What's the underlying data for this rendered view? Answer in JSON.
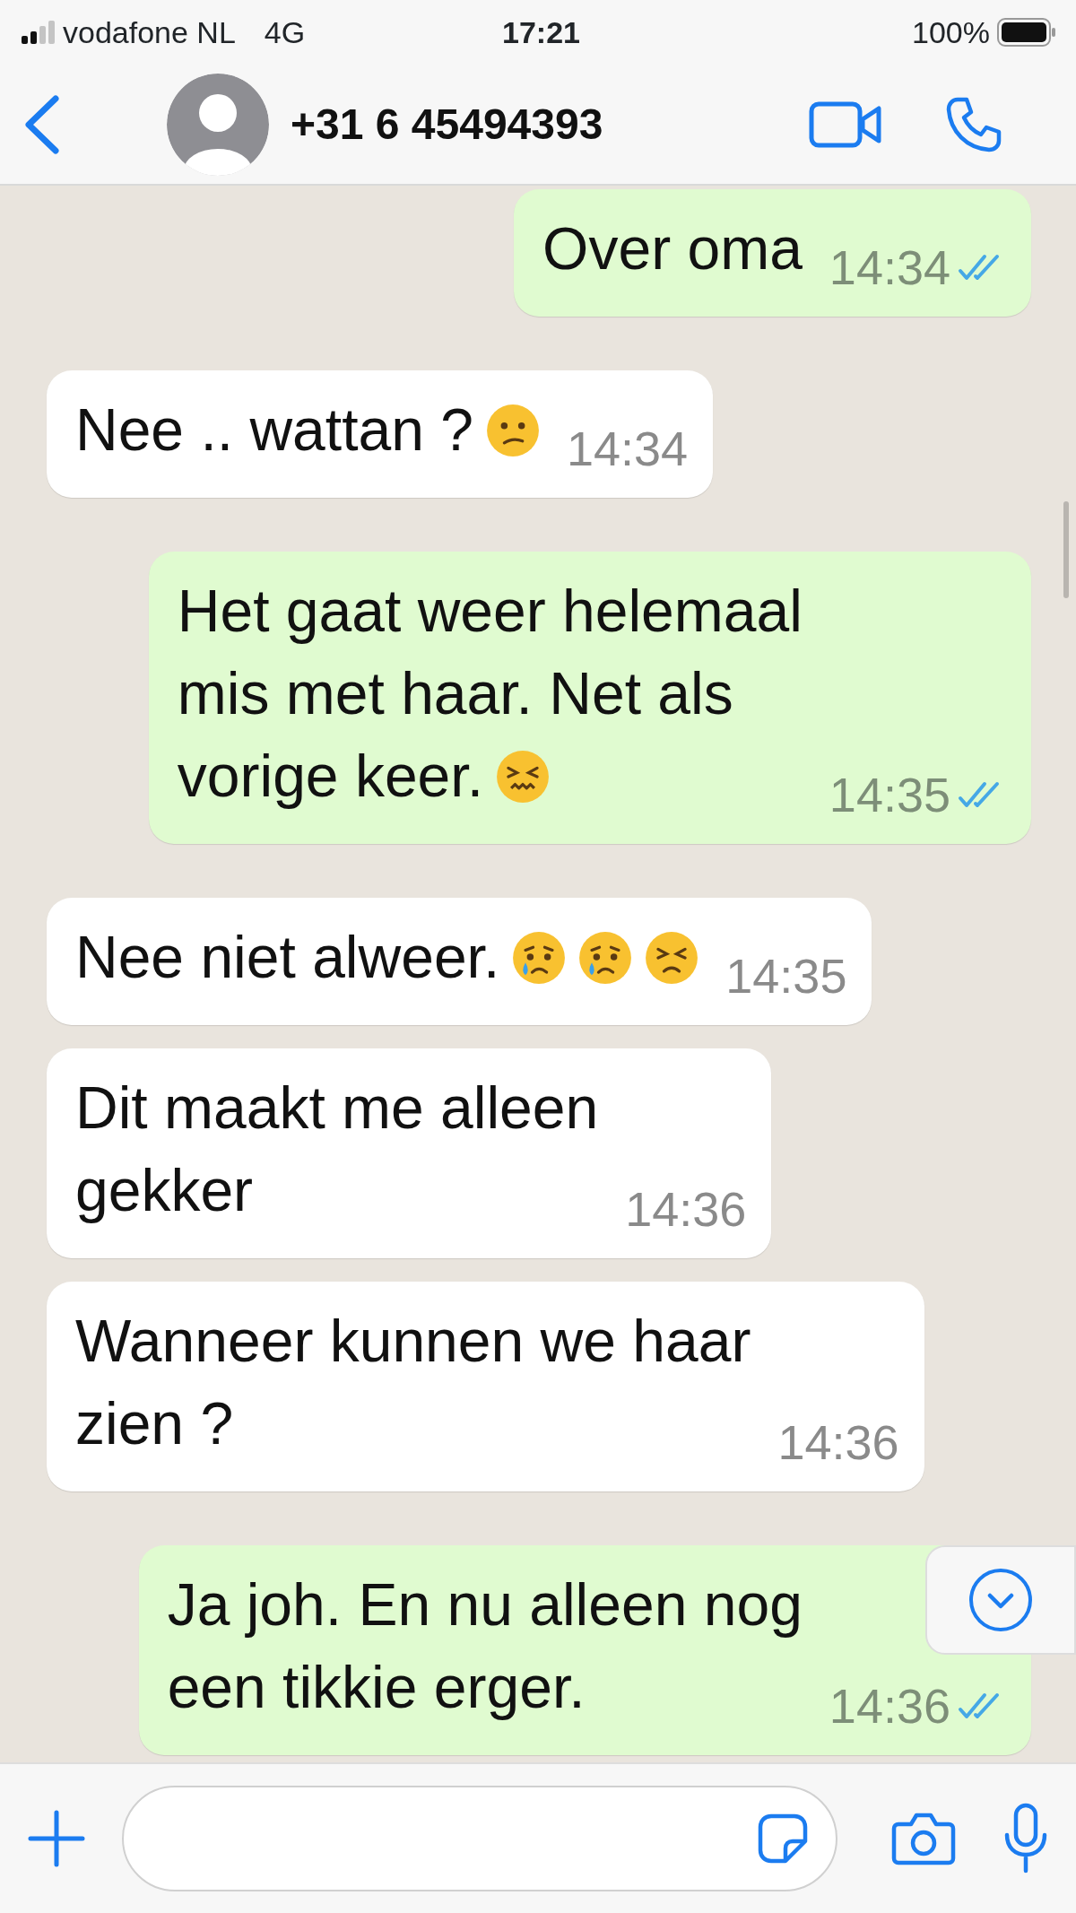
{
  "status_bar": {
    "carrier": "vodafone NL",
    "network": "4G",
    "time": "17:21",
    "battery": "100%"
  },
  "header": {
    "contact": "+31 6 45494393"
  },
  "messages": [
    {
      "kind": "outgoing",
      "text": "Over oma",
      "time": "14:34",
      "read": true
    },
    {
      "kind": "incoming",
      "text": "Nee .. wattan ?",
      "emojis": [
        {
          "kind": "confused"
        }
      ],
      "time": "14:34"
    },
    {
      "kind": "outgoing",
      "text": "Het gaat weer helemaal\nmis met haar. Net als\nvorige keer.",
      "emojis": [
        {
          "kind": "confounded"
        }
      ],
      "time": "14:35",
      "read": true
    },
    {
      "kind": "incoming",
      "text": "Nee niet alweer.",
      "emojis": [
        {
          "kind": "crying"
        },
        {
          "kind": "crying"
        },
        {
          "kind": "persevering"
        }
      ],
      "time": "14:35"
    },
    {
      "kind": "incoming",
      "text": "Dit maakt me alleen\ngekker",
      "time": "14:36"
    },
    {
      "kind": "incoming",
      "text": "Wanneer kunnen we haar\nzien ?",
      "time": "14:36"
    },
    {
      "kind": "outgoing",
      "text": "Ja joh. En nu alleen nog\neen tikkie erger.",
      "time": "14:36",
      "read": true
    }
  ]
}
